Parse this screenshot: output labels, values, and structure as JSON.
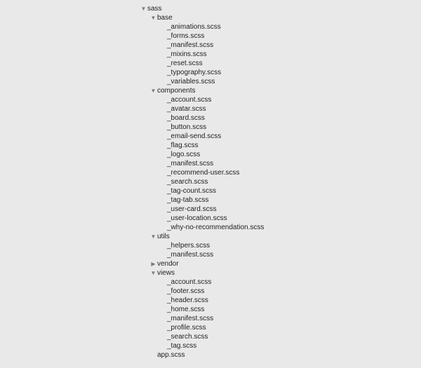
{
  "tree": [
    {
      "label": "sass",
      "indent": 0,
      "arrow": "down",
      "type": "folder"
    },
    {
      "label": "base",
      "indent": 1,
      "arrow": "down",
      "type": "folder"
    },
    {
      "label": "_animations.scss",
      "indent": 2,
      "arrow": "none",
      "type": "file"
    },
    {
      "label": "_forms.scss",
      "indent": 2,
      "arrow": "none",
      "type": "file"
    },
    {
      "label": "_manifest.scss",
      "indent": 2,
      "arrow": "none",
      "type": "file"
    },
    {
      "label": "_mixins.scss",
      "indent": 2,
      "arrow": "none",
      "type": "file"
    },
    {
      "label": "_reset.scss",
      "indent": 2,
      "arrow": "none",
      "type": "file"
    },
    {
      "label": "_typography.scss",
      "indent": 2,
      "arrow": "none",
      "type": "file"
    },
    {
      "label": "_variables.scss",
      "indent": 2,
      "arrow": "none",
      "type": "file"
    },
    {
      "label": "components",
      "indent": 1,
      "arrow": "down",
      "type": "folder"
    },
    {
      "label": "_account.scss",
      "indent": 2,
      "arrow": "none",
      "type": "file"
    },
    {
      "label": "_avatar.scss",
      "indent": 2,
      "arrow": "none",
      "type": "file"
    },
    {
      "label": "_board.scss",
      "indent": 2,
      "arrow": "none",
      "type": "file"
    },
    {
      "label": "_button.scss",
      "indent": 2,
      "arrow": "none",
      "type": "file"
    },
    {
      "label": "_email-send.scss",
      "indent": 2,
      "arrow": "none",
      "type": "file"
    },
    {
      "label": "_flag.scss",
      "indent": 2,
      "arrow": "none",
      "type": "file"
    },
    {
      "label": "_logo.scss",
      "indent": 2,
      "arrow": "none",
      "type": "file"
    },
    {
      "label": "_manifest.scss",
      "indent": 2,
      "arrow": "none",
      "type": "file"
    },
    {
      "label": "_recommend-user.scss",
      "indent": 2,
      "arrow": "none",
      "type": "file"
    },
    {
      "label": "_search.scss",
      "indent": 2,
      "arrow": "none",
      "type": "file"
    },
    {
      "label": "_tag-count.scss",
      "indent": 2,
      "arrow": "none",
      "type": "file"
    },
    {
      "label": "_tag-tab.scss",
      "indent": 2,
      "arrow": "none",
      "type": "file"
    },
    {
      "label": "_user-card.scss",
      "indent": 2,
      "arrow": "none",
      "type": "file"
    },
    {
      "label": "_user-location.scss",
      "indent": 2,
      "arrow": "none",
      "type": "file"
    },
    {
      "label": "_why-no-recommendation.scss",
      "indent": 2,
      "arrow": "none",
      "type": "file"
    },
    {
      "label": "utils",
      "indent": 1,
      "arrow": "down",
      "type": "folder"
    },
    {
      "label": "_helpers.scss",
      "indent": 2,
      "arrow": "none",
      "type": "file"
    },
    {
      "label": "_manifest.scss",
      "indent": 2,
      "arrow": "none",
      "type": "file"
    },
    {
      "label": "vendor",
      "indent": 1,
      "arrow": "right",
      "type": "folder"
    },
    {
      "label": "views",
      "indent": 1,
      "arrow": "down",
      "type": "folder"
    },
    {
      "label": "_account.scss",
      "indent": 2,
      "arrow": "none",
      "type": "file"
    },
    {
      "label": "_footer.scss",
      "indent": 2,
      "arrow": "none",
      "type": "file"
    },
    {
      "label": "_header.scss",
      "indent": 2,
      "arrow": "none",
      "type": "file"
    },
    {
      "label": "_home.scss",
      "indent": 2,
      "arrow": "none",
      "type": "file"
    },
    {
      "label": "_manifest.scss",
      "indent": 2,
      "arrow": "none",
      "type": "file"
    },
    {
      "label": "_profile.scss",
      "indent": 2,
      "arrow": "none",
      "type": "file"
    },
    {
      "label": "_search.scss",
      "indent": 2,
      "arrow": "none",
      "type": "file"
    },
    {
      "label": "_tag.scss",
      "indent": 2,
      "arrow": "none",
      "type": "file"
    },
    {
      "label": "app.scss",
      "indent": 1,
      "arrow": "none",
      "type": "file"
    }
  ]
}
